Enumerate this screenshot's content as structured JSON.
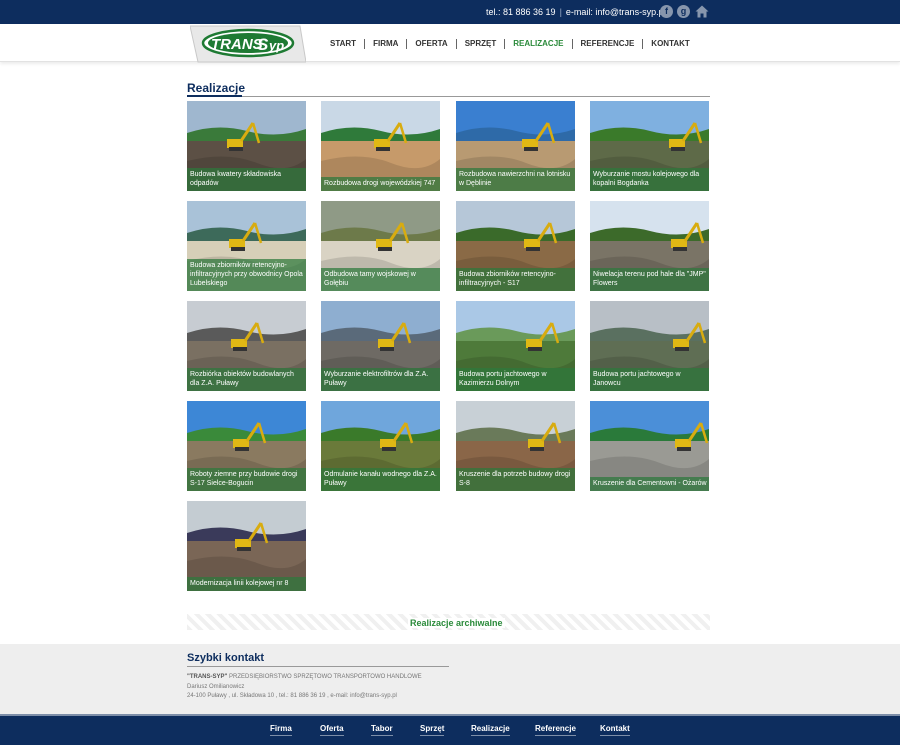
{
  "topbar": {
    "phone": "tel.: 81 886 36 19",
    "separator": "|",
    "email": "e-mail: info@trans-syp.pl",
    "icons": [
      "facebook-icon",
      "google-plus-icon",
      "home-icon"
    ],
    "facebook_glyph": "f",
    "google_glyph": "g"
  },
  "logo": {
    "text_main": "TRANS",
    "text_suffix": "yp",
    "text_s": "S"
  },
  "menu": {
    "items": [
      {
        "label": "START"
      },
      {
        "label": "FIRMA"
      },
      {
        "label": "OFERTA"
      },
      {
        "label": "SPRZĘT"
      },
      {
        "label": "REALIZACJE",
        "active": true
      },
      {
        "label": "REFERENCJE"
      },
      {
        "label": "KONTAKT"
      }
    ]
  },
  "page": {
    "title": "Realizacje",
    "archive_link": "Realizacje archiwalne"
  },
  "gallery": [
    {
      "caption": "Budowa kwatery składowiska odpadów"
    },
    {
      "caption": "Rozbudowa drogi wojewódzkiej 747"
    },
    {
      "caption": "Rozbudowa nawierzchni na lotnisku w Dęblinie"
    },
    {
      "caption": "Wyburzanie mostu kolejowego dla kopalni Bogdanka"
    },
    {
      "caption": "Budowa zbiorników retencyjno-infiltracyjnych przy obwodnicy Opola Lubelskiego"
    },
    {
      "caption": "Odbudowa tamy wojskowej w Gołębiu"
    },
    {
      "caption": "Budowa zbiorników retencyjno-infiltracyjnych - S17"
    },
    {
      "caption": "Niwelacja terenu pod hale dla \"JMP\" Flowers"
    },
    {
      "caption": "Rozbiórka obiektów budowlanych dla Z.A. Puławy"
    },
    {
      "caption": "Wyburzanie elektrofiltrów dla Z.A. Puławy"
    },
    {
      "caption": "Budowa portu jachtowego w Kazimierzu Dolnym"
    },
    {
      "caption": "Budowa portu jachtowego w Janowcu"
    },
    {
      "caption": "Roboty ziemne przy budowie drogi S-17 Sielce-Bogucin"
    },
    {
      "caption": "Odmulanie kanału wodnego dla Z.A. Puławy"
    },
    {
      "caption": "Kruszenie dla potrzeb budowy drogi S-8"
    },
    {
      "caption": "Kruszenie dla Cementowni - Ożarów"
    },
    {
      "caption": "Modernizacja linii kolejowej nr 8"
    }
  ],
  "quick_contact": {
    "title": "Szybki kontakt",
    "company_name": "\"TRANS-SYP\"",
    "company_desc": "PRZEDSIĘBIORSTWO SPRZĘTOWO TRANSPORTOWO HANDLOWE",
    "owner": "Dariusz Omilianowicz",
    "address": "24-100 Puławy , ul. Składowa 10 , tel.: 81 886 36 19 , e-mail: info@trans-syp.pl"
  },
  "footer": {
    "items": [
      {
        "label": "Firma"
      },
      {
        "label": "Oferta"
      },
      {
        "label": "Tabor"
      },
      {
        "label": "Sprzęt"
      },
      {
        "label": "Realizacje"
      },
      {
        "label": "Referencje"
      },
      {
        "label": "Kontakt"
      }
    ]
  },
  "colors": {
    "brand_navy": "#0d2d5e",
    "brand_green": "#2a8a3a",
    "caption_overlay": "#2c783c"
  }
}
